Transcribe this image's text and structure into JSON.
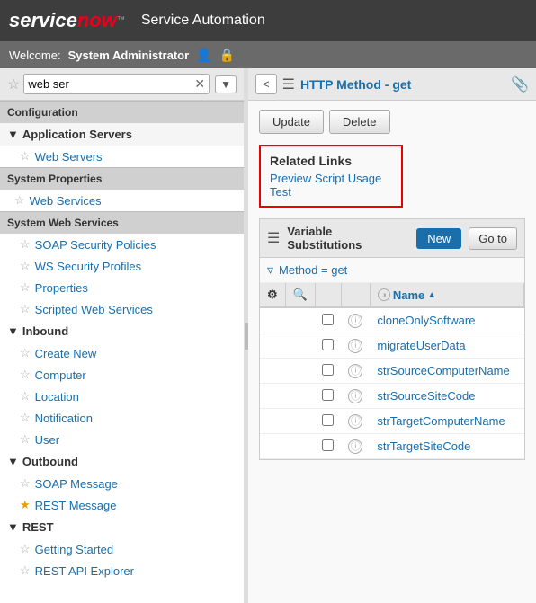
{
  "header": {
    "logo_service": "service",
    "logo_now": "now",
    "logo_tm": "™",
    "title": "Service Automation"
  },
  "welcome": {
    "label": "Welcome:",
    "user": "System Administrator",
    "user_icon": "👤",
    "lock_icon": "🔒"
  },
  "sidebar": {
    "search_value": "web ser",
    "search_placeholder": "web ser",
    "sections": {
      "configuration": "Configuration",
      "system_properties": "System Properties",
      "system_web_services": "System Web Services"
    },
    "items": {
      "application_servers": "Application Servers",
      "web_servers": "Web Servers",
      "web_services": "Web Services",
      "soap_security_policies": "SOAP Security Policies",
      "ws_security_profiles": "WS Security Profiles",
      "properties": "Properties",
      "scripted_web_services": "Scripted Web Services",
      "inbound": "Inbound",
      "create_new": "Create New",
      "computer": "Computer",
      "location": "Location",
      "notification": "Notification",
      "user": "User",
      "outbound": "Outbound",
      "soap_message": "SOAP Message",
      "rest_message": "REST Message",
      "rest": "REST",
      "getting_started": "Getting Started",
      "rest_api_explorer": "REST API Explorer"
    }
  },
  "content": {
    "back_button": "<",
    "toolbar_title": "HTTP Method - get",
    "update_button": "Update",
    "delete_button": "Delete",
    "related_links": {
      "title": "Related Links",
      "links": [
        "Preview Script Usage",
        "Test"
      ]
    },
    "var_section": {
      "title": "Variable Substitutions",
      "new_button": "New",
      "goto_button": "Go to",
      "filter_text": "Method = get",
      "columns": {
        "name": "Name",
        "sort": "▲"
      },
      "rows": [
        "cloneOnlySoftware",
        "migrateUserData",
        "strSourceComputerName",
        "strSourceSiteCode",
        "strTargetComputerName",
        "strTargetSiteCode"
      ]
    }
  }
}
